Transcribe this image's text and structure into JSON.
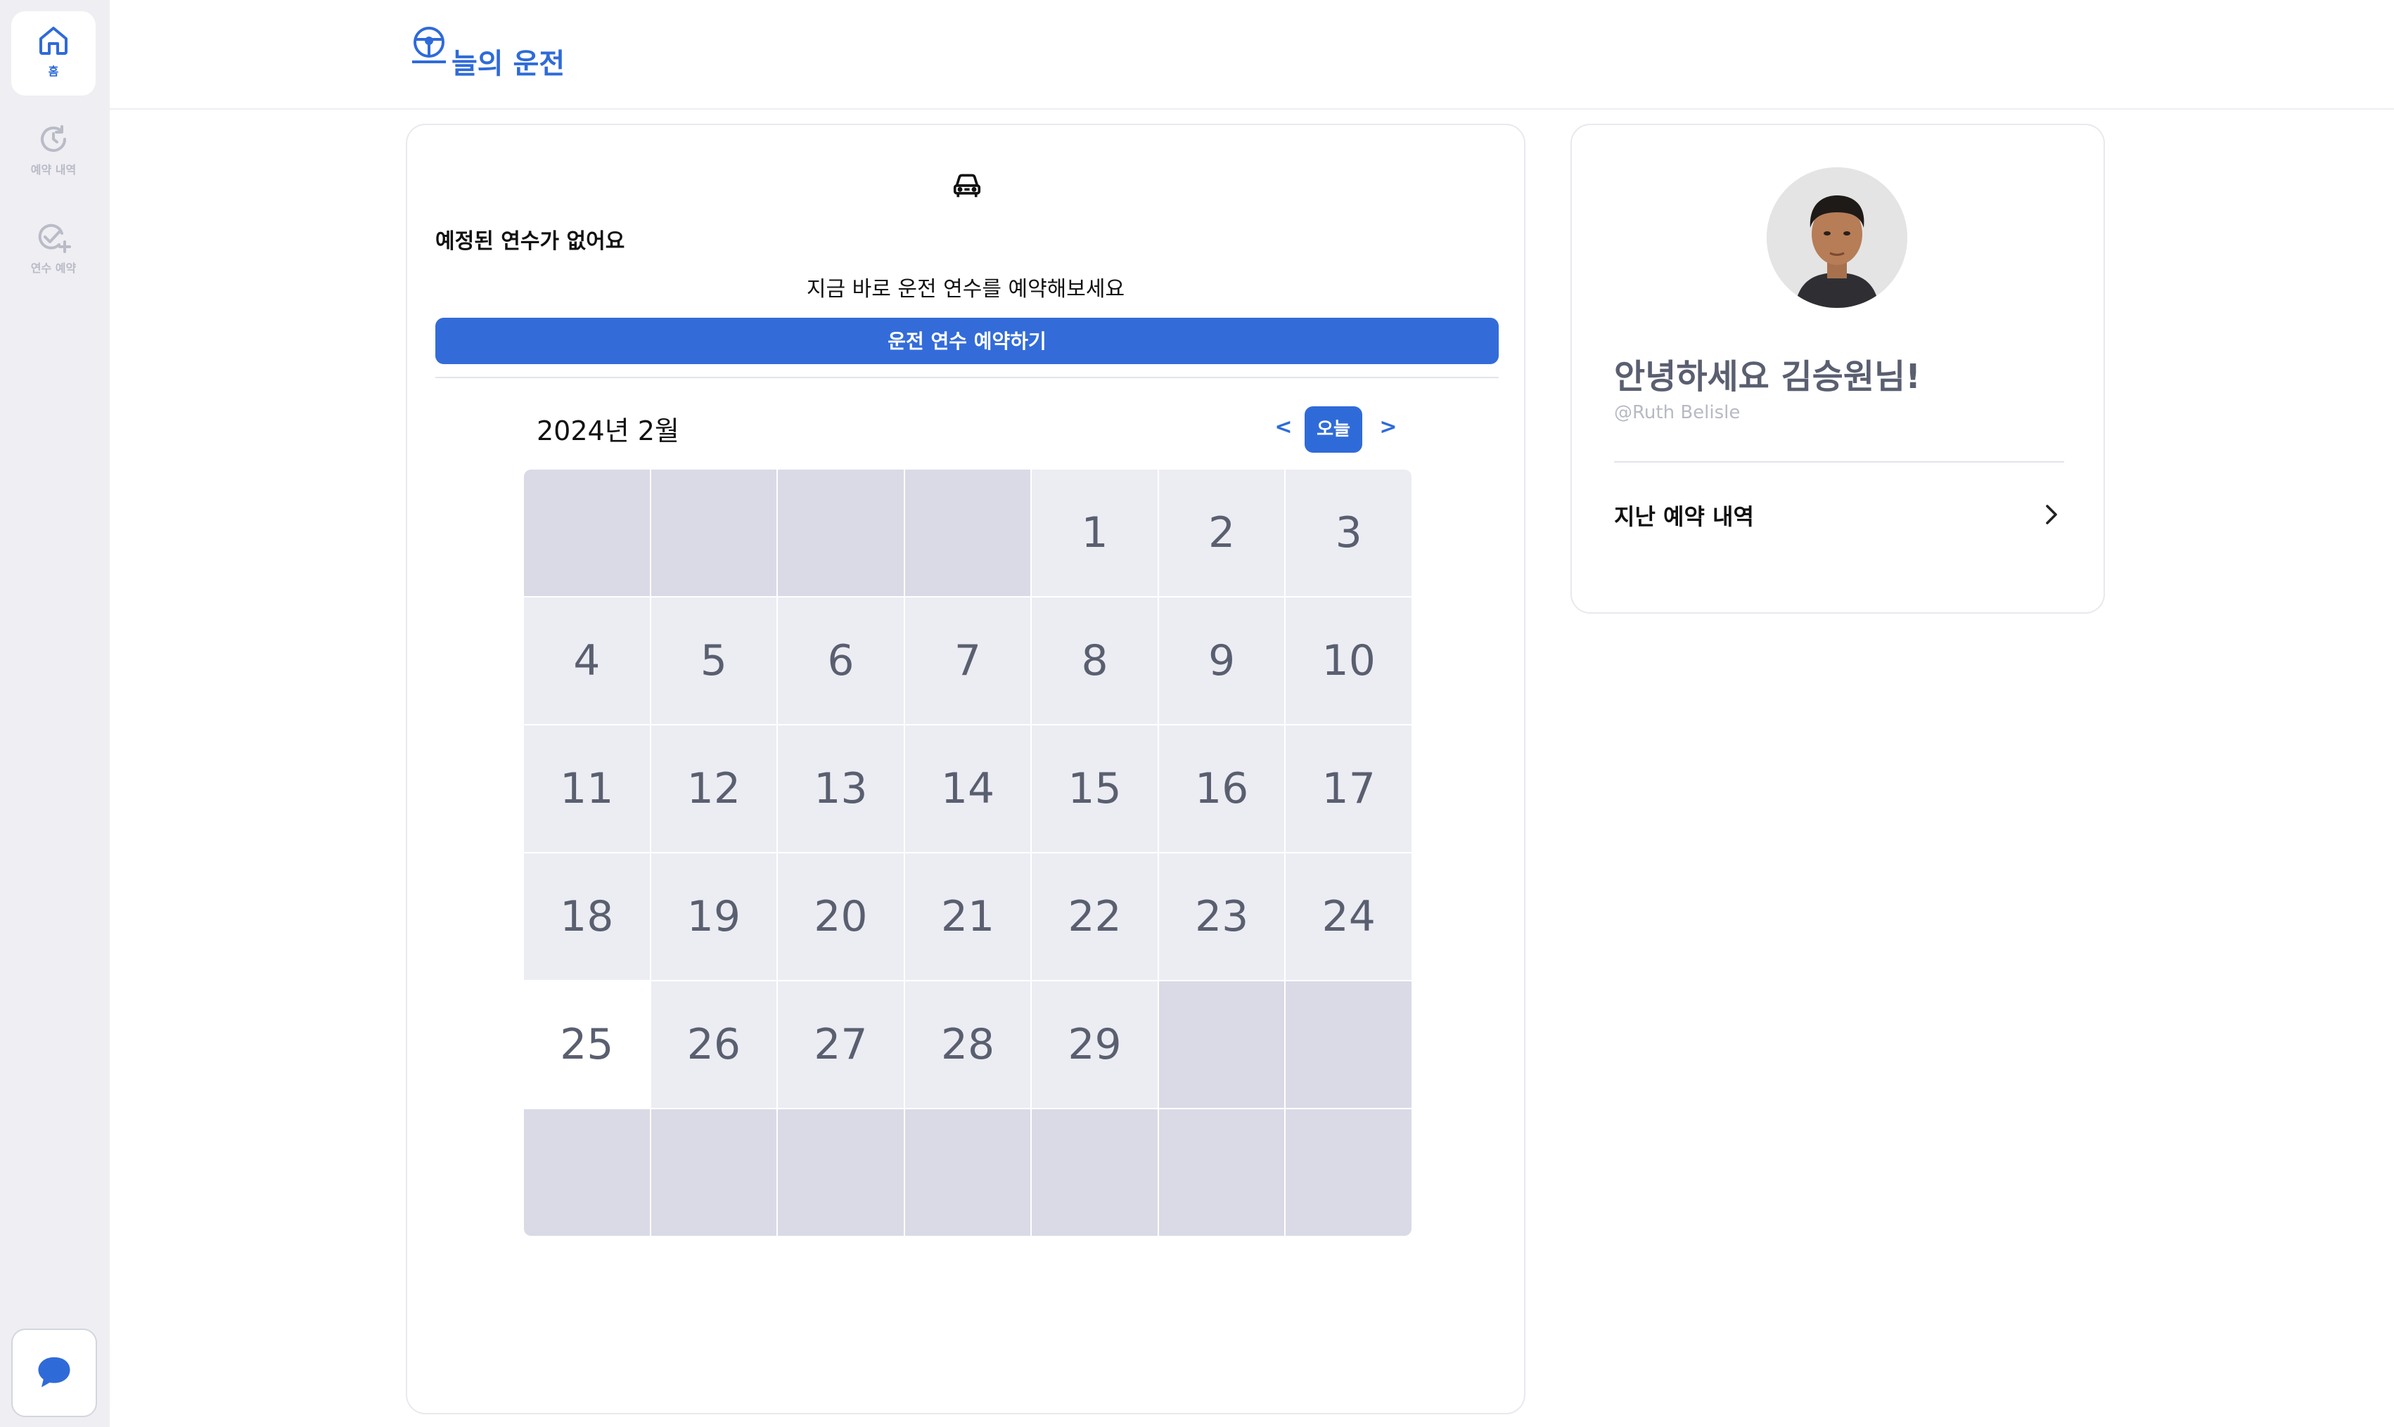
{
  "sidebar": {
    "items": [
      {
        "label": "홈",
        "icon": "home-icon",
        "active": true
      },
      {
        "label": "예약 내역",
        "icon": "history-icon",
        "active": false
      },
      {
        "label": "연수 예약",
        "icon": "check-add-icon",
        "active": false
      }
    ],
    "chat_icon": "chat-icon"
  },
  "header": {
    "logo_text": "늘의 운전",
    "logo_icon": "steering-wheel-icon"
  },
  "main": {
    "car_icon": "car-icon",
    "empty_title": "예정된 연수가 없어요",
    "cta_subtitle": "지금 바로 운전 연수를 예약해보세요",
    "cta_button": "운전 연수 예약하기",
    "calendar": {
      "month_label": "2024년 2월",
      "prev_label": "<",
      "next_label": ">",
      "today_label": "오늘",
      "days": [
        "",
        "",
        "",
        "",
        "1",
        "2",
        "3",
        "4",
        "5",
        "6",
        "7",
        "8",
        "9",
        "10",
        "11",
        "12",
        "13",
        "14",
        "15",
        "16",
        "17",
        "18",
        "19",
        "20",
        "21",
        "22",
        "23",
        "24",
        "25",
        "26",
        "27",
        "28",
        "29",
        "",
        "",
        "",
        "",
        "",
        "",
        "",
        "",
        ""
      ],
      "today_day": "25"
    }
  },
  "profile": {
    "greeting": "안녕하세요 김승원님!",
    "handle": "@Ruth Belisle",
    "history_label": "지난 예약 내역"
  },
  "colors": {
    "accent": "#2f6bd8",
    "sidebar_bg": "#eeeef3",
    "calendar_cell": "#ecedf3",
    "calendar_empty": "#d9dae6"
  }
}
